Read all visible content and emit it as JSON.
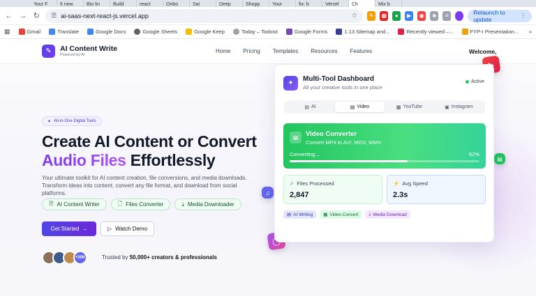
{
  "browser": {
    "tabs": [
      "Your F",
      "6 new",
      "Bio lin",
      "Build",
      "react",
      "Onbo",
      "Sai",
      "Deep",
      "Shopp",
      "Your",
      "fix: b",
      "Vercel",
      "Ch",
      "Mix b"
    ],
    "url": "ai-saas-next-react-js.vercel.app",
    "relaunch_label": "Relaunch to update",
    "bookmarks": [
      "Gmail",
      "Translate",
      "Google Docs",
      "Google Sheets",
      "Google Keep",
      "Today – Todoist",
      "Google Forms",
      "1.13 Sitemap and...",
      "Recently viewed –...",
      "FYP-I Presentation..."
    ]
  },
  "nav": {
    "brand": "AI Content Write",
    "brand_sub": "Powered by AI",
    "menu": [
      "Home",
      "Pricing",
      "Templates",
      "Resources",
      "Features"
    ],
    "welcome": "Welcome,"
  },
  "hero": {
    "badge": "All-in-One Digital Tools",
    "title_line1": "Create AI Content or Convert",
    "title_grad": "Audio Files",
    "title_rest": "Effortlessly",
    "lead": "Your ultimate toolkit for AI content creation, file conversions, and media downloads. Transform ideas into content, convert any file format, and download from social platforms.",
    "chips": [
      "AI Content Writer",
      "Files Converter",
      "Media Downloader"
    ],
    "primary_cta": "Get Started",
    "secondary_cta": "Watch Demo",
    "avatar_more": "+50K",
    "trust_prefix": "Trusted by ",
    "trust_bold": "50,000+ creators & professionals"
  },
  "dashboard": {
    "title": "Multi-Tool Dashboard",
    "subtitle": "All your creative tools in one place",
    "status": "Active",
    "tabs": [
      "AI",
      "Video",
      "YouTube",
      "Instagram"
    ],
    "converter_title": "Video Converter",
    "converter_sub": "Convert MP4 to AVI, MOV, WMV",
    "converter_status": "Converting...",
    "converter_pct": "62%",
    "progress": 0.62,
    "stats": [
      {
        "label": "Files Processed",
        "value": "2,847"
      },
      {
        "label": "Avg Speed",
        "value": "2.3s"
      }
    ],
    "tags": [
      "AI Writing",
      "Video Convert",
      "Media Download"
    ]
  },
  "colors": {
    "accent": "#4f46e5",
    "purple": "#7c3aed",
    "green": "#22c55e"
  }
}
